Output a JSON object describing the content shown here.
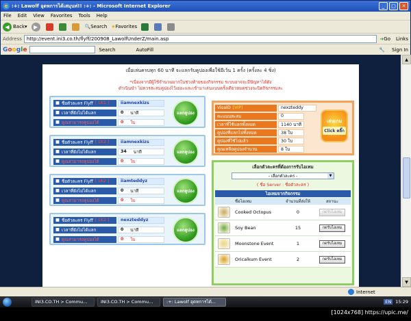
{
  "window": {
    "title": ":+: Lawolf อุดหการได้เสมุนท่!! :+: - Microsoft Internet Explorer"
  },
  "menu": [
    "File",
    "Edit",
    "View",
    "Favorites",
    "Tools",
    "Help"
  ],
  "toolbar": {
    "back": "Back",
    "search": "Search",
    "favorites": "Favorites"
  },
  "address": {
    "label": "Address",
    "url": "http://event.ini3.co.th/flyff/200908_LawolfUnderZ/main.asp",
    "go": "Go",
    "links": "Links"
  },
  "google": {
    "search": "Search",
    "autofill": "AutoFill",
    "signin": "Sign In"
  },
  "page": {
    "header": "เมื่อเล่นครบทุก 60 นาที จะแลกรับคูปองเพื่อใช้อีเว้น 1 ครั้ง (ครั้งละ 4 ชิ่ง)",
    "notice1": "*เนื่องจากมีผู้ใช้จำนวนมากในช่วงท้ายของกิจกรรม ระบบอาจจะมีปัญหาได้ดัง",
    "notice2": "ดำเนินนำ ไม่ควรสะสมคูปองไว้เยอะและเข้ามาเล่นแบบครั้งเดียวหมดช่วงจะปิดกิจกรรมละ"
  },
  "chars": [
    {
      "name_label": "ชื่อตัวละคร Flyff",
      "lk": "[ LK1 ]",
      "name": "iiamnexkizs",
      "time_label": "เวลาที่ยังไม่ได้แลก",
      "time": "0",
      "unit": "นาที",
      "coupon_label": "คูณสามารถคูปองได้",
      "coupon": "0",
      "coupon_unit": "ใบ",
      "btn": "แลกคูปอง"
    },
    {
      "name_label": "ชื่อตัวละคร Flyff",
      "lk": "[ LK2 ]",
      "name": "iiamnexkizs",
      "time_label": "เวลาที่ยังไม่ได้แลก",
      "time": "34",
      "unit": "นาที",
      "coupon_label": "คูณสามารถคูปองได้",
      "coupon": "0",
      "coupon_unit": "ใบ",
      "btn": "แลกคูปอง"
    },
    {
      "name_label": "ชื่อตัวละคร Flyff",
      "lk": "[ LK2 ]",
      "name": "iiamteddyz",
      "time_label": "เวลาที่ยังไม่ได้แลก",
      "time": "0",
      "unit": "นาที",
      "coupon_label": "คูณสามารถคูปองได้",
      "coupon": "0",
      "coupon_unit": "ใบ",
      "btn": "แลกคูปอง"
    },
    {
      "name_label": "ชื่อตัวละคร Flyff",
      "lk": "[ LK2 ]",
      "name": "nexzteddyz",
      "time_label": "เวลาที่ยังไม่ได้แลก",
      "time": "0",
      "unit": "นาที",
      "coupon_label": "คูณสามารถคูปองได้",
      "coupon": "0",
      "coupon_unit": "ใบ",
      "btn": "แลกคูปอง"
    }
  ],
  "vip": {
    "rows": [
      {
        "label": "VisaID",
        "tag": "[VIP]",
        "value": "nexzteddy"
      },
      {
        "label": "คะแนนสะสม",
        "value": "0"
      },
      {
        "label": "เวลาที่ใช้แลกทั้งหมด",
        "value": "1140 นาที"
      },
      {
        "label": "คูปองที่แลกไปทั้งหมด",
        "value": "38 ใบ"
      },
      {
        "label": "คูปองที่ใช้ไปแล้ว",
        "value": "30 ใบ"
      },
      {
        "label": "คูณเหลือคูปองจำนวน",
        "value": "8 ใบ"
      }
    ],
    "play_btn": "เล่นเกม",
    "play_sub": "Click คลิ๊ก"
  },
  "items": {
    "title": "เลือกตัวละครที่ต้องการรับไอเทม",
    "select": "- เลือกตัวละคร -",
    "server": "( ชื่อ Server : ชื่อตัวละคร )",
    "table_title": "ไอเทมจากกิจกรรม",
    "cols": [
      "ชื่อไอเทม",
      "จำนวนที่ส่งให้",
      "สถานะ"
    ],
    "rows": [
      {
        "name": "Cooked Octopus",
        "qty": "0",
        "btn": "กดรับไอเทม",
        "enabled": false,
        "icon": "octopus-icon",
        "color": "#c9a86b"
      },
      {
        "name": "Soy Bean",
        "qty": "15",
        "btn": "กดรับไอเทม",
        "enabled": true,
        "icon": "soybean-icon",
        "color": "#6fa84a"
      },
      {
        "name": "Moonstone Event",
        "qty": "1",
        "btn": "กดรับไอเทม",
        "enabled": true,
        "icon": "moonstone-icon",
        "color": "#e8d48a"
      },
      {
        "name": "Oricalkum Event",
        "qty": "2",
        "btn": "กดรับไอเทม",
        "enabled": true,
        "icon": "oricalkum-icon",
        "color": "#d8a02a"
      }
    ]
  },
  "status": {
    "text": "",
    "zone": "Internet"
  },
  "taskbar": {
    "tasks": [
      "INI3.CO.TH > Commu...",
      "INI3.CO.TH > Commu...",
      ":+: Lawolf อุดหการได้..."
    ],
    "lang": "EN",
    "time": "15:29"
  },
  "caption": "[1024x768] https://upic.me/"
}
